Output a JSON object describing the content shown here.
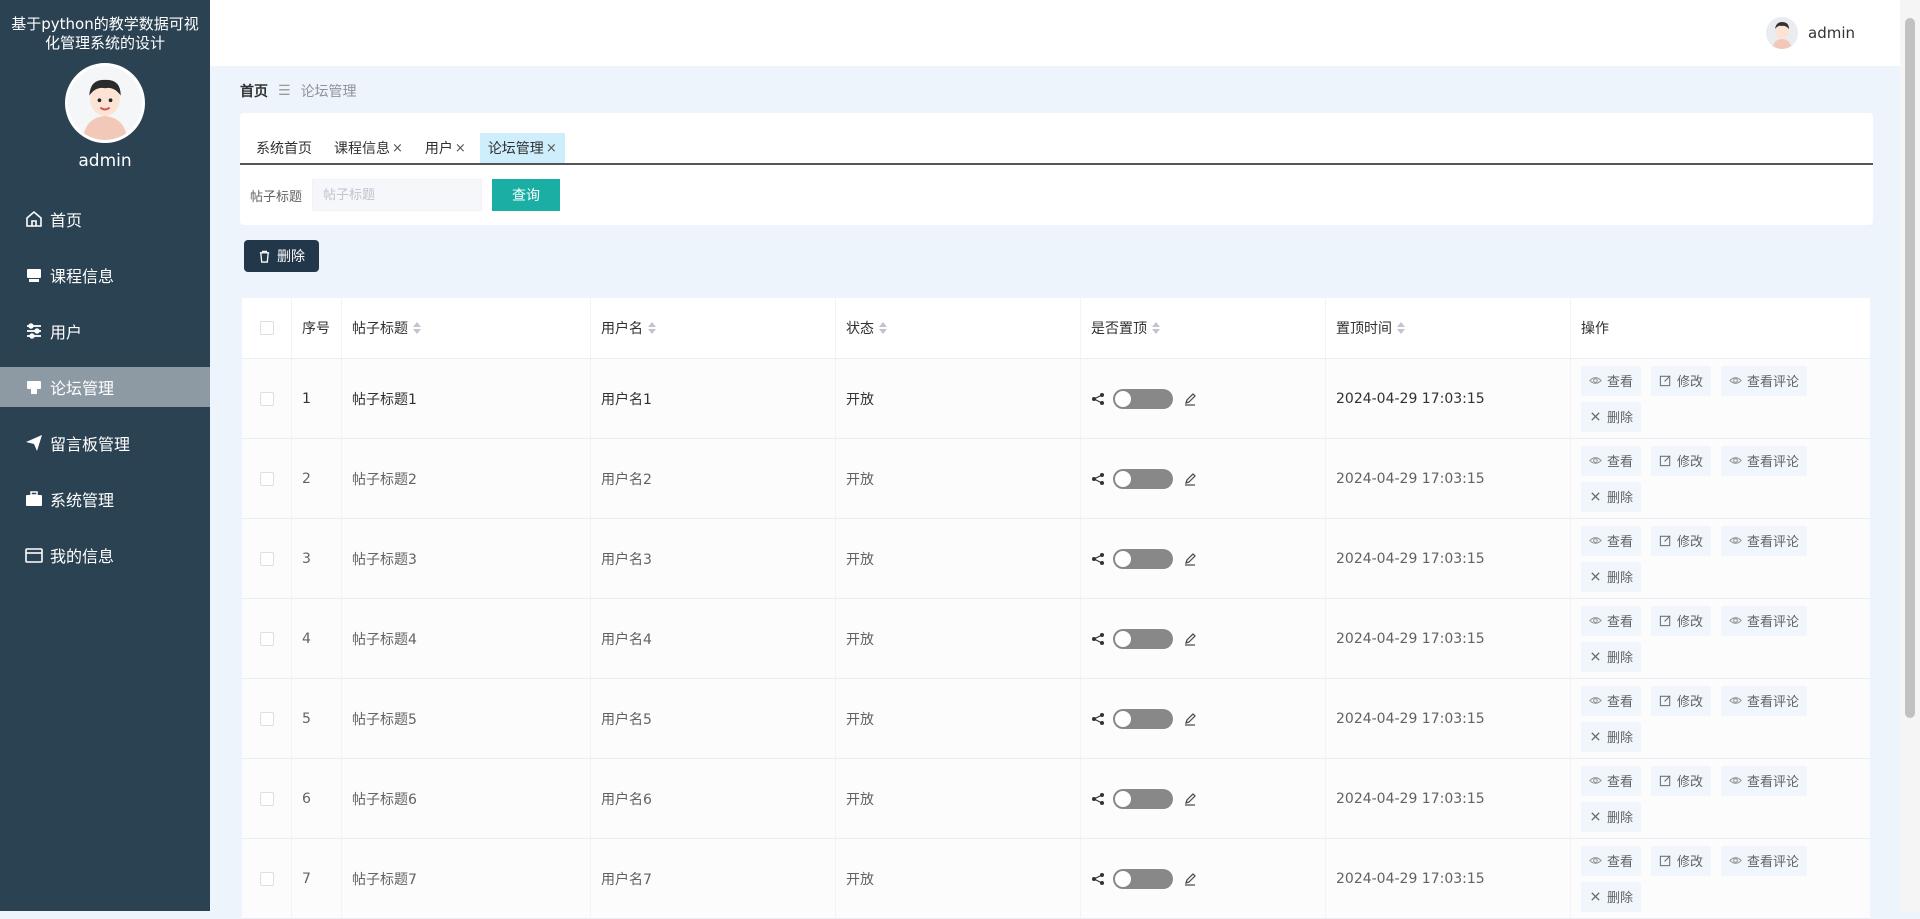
{
  "app": {
    "title": "基于python的教学数据可视化管理系统的设计",
    "username": "admin"
  },
  "sidebar": {
    "items": [
      {
        "label": "首页",
        "icon": "home-icon"
      },
      {
        "label": "课程信息",
        "icon": "book-icon"
      },
      {
        "label": "用户",
        "icon": "sliders-icon"
      },
      {
        "label": "论坛管理",
        "icon": "forum-icon",
        "active": true
      },
      {
        "label": "留言板管理",
        "icon": "paper-plane-icon"
      },
      {
        "label": "系统管理",
        "icon": "briefcase-icon"
      },
      {
        "label": "我的信息",
        "icon": "card-icon"
      }
    ]
  },
  "breadcrumb": {
    "home": "首页",
    "separator": "☰",
    "current": "论坛管理"
  },
  "tabs": [
    {
      "label": "系统首页",
      "closable": false
    },
    {
      "label": "课程信息",
      "closable": true
    },
    {
      "label": "用户",
      "closable": true
    },
    {
      "label": "论坛管理",
      "closable": true,
      "active": true
    }
  ],
  "tab_close_glyph": "×",
  "search": {
    "label": "帖子标题",
    "placeholder": "帖子标题",
    "button": "查询"
  },
  "toolbar": {
    "delete_label": "删除"
  },
  "table": {
    "headers": {
      "index": "序号",
      "title": "帖子标题",
      "user": "用户名",
      "state": "状态",
      "pinned": "是否置顶",
      "pin_time": "置顶时间",
      "ops": "操作"
    },
    "ops": {
      "view": "查看",
      "edit": "修改",
      "comments": "查看评论",
      "delete": "删除"
    },
    "rows": [
      {
        "index": "1",
        "title": "帖子标题1",
        "user": "用户名1",
        "state": "开放",
        "pinned": false,
        "pin_time": "2024-04-29 17:03:15"
      },
      {
        "index": "2",
        "title": "帖子标题2",
        "user": "用户名2",
        "state": "开放",
        "pinned": false,
        "pin_time": "2024-04-29 17:03:15"
      },
      {
        "index": "3",
        "title": "帖子标题3",
        "user": "用户名3",
        "state": "开放",
        "pinned": false,
        "pin_time": "2024-04-29 17:03:15"
      },
      {
        "index": "4",
        "title": "帖子标题4",
        "user": "用户名4",
        "state": "开放",
        "pinned": false,
        "pin_time": "2024-04-29 17:03:15"
      },
      {
        "index": "5",
        "title": "帖子标题5",
        "user": "用户名5",
        "state": "开放",
        "pinned": false,
        "pin_time": "2024-04-29 17:03:15"
      },
      {
        "index": "6",
        "title": "帖子标题6",
        "user": "用户名6",
        "state": "开放",
        "pinned": false,
        "pin_time": "2024-04-29 17:03:15"
      },
      {
        "index": "7",
        "title": "帖子标题7",
        "user": "用户名7",
        "state": "开放",
        "pinned": false,
        "pin_time": "2024-04-29 17:03:15"
      }
    ]
  },
  "colors": {
    "sidebar": "#2b4253",
    "accent": "#1aaea4",
    "active_tab": "#cdeefa",
    "delete_button": "#22384a"
  }
}
